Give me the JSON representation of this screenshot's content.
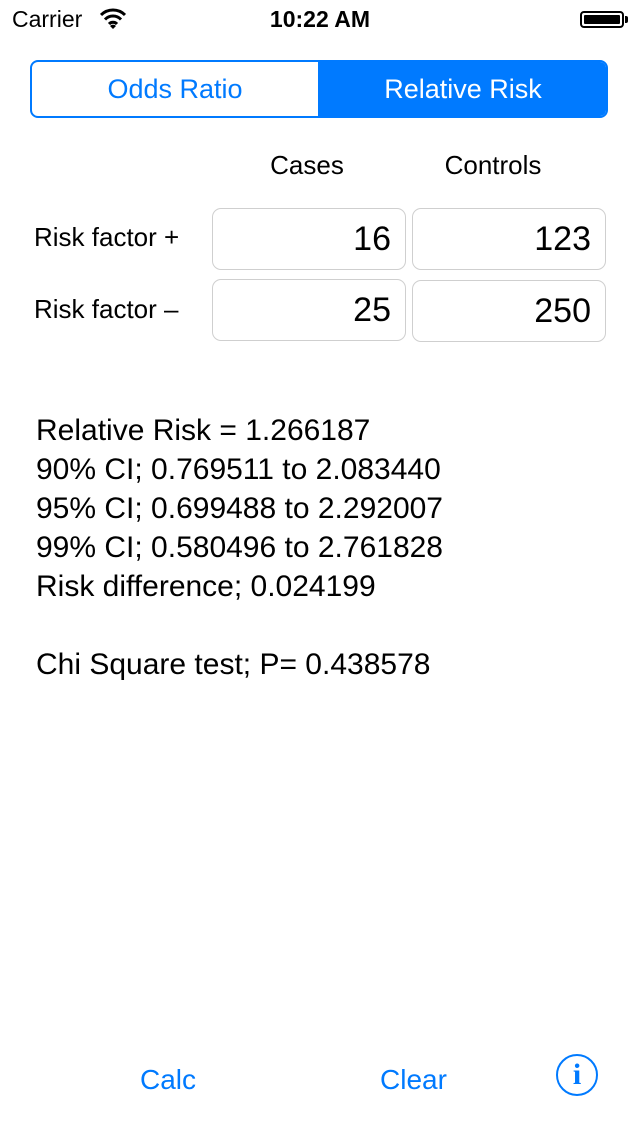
{
  "status_bar": {
    "carrier": "Carrier",
    "time": "10:22 AM",
    "wifi_icon": "wifi-icon",
    "battery_icon": "battery-full-icon"
  },
  "segmented_control": {
    "segments": [
      {
        "label": "Odds Ratio",
        "selected": false
      },
      {
        "label": "Relative Risk",
        "selected": true
      }
    ],
    "accent_color": "#007aff"
  },
  "table": {
    "columns": [
      "Cases",
      "Controls"
    ],
    "rows": [
      {
        "label": "Risk factor +",
        "values": [
          "16",
          "123"
        ]
      },
      {
        "label": "Risk factor –",
        "values": [
          "25",
          "250"
        ]
      }
    ]
  },
  "results": {
    "lines": [
      "Relative Risk = 1.266187",
      "90% CI; 0.769511 to 2.083440",
      "95% CI; 0.699488 to 2.292007",
      "99% CI; 0.580496 to 2.761828",
      "Risk difference; 0.024199",
      "",
      "Chi Square test; P= 0.438578"
    ]
  },
  "toolbar": {
    "calc_label": "Calc",
    "clear_label": "Clear",
    "info_icon": "i"
  }
}
